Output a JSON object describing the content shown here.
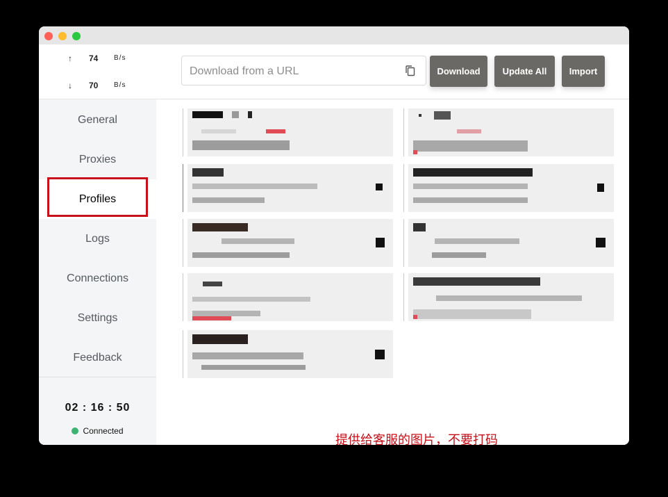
{
  "traffic": {
    "up": {
      "arrow": "↑",
      "value": "74",
      "unit": "B/s"
    },
    "down": {
      "arrow": "↓",
      "value": "70",
      "unit": "B/s"
    }
  },
  "nav": {
    "items": [
      {
        "label": "General"
      },
      {
        "label": "Proxies"
      },
      {
        "label": "Profiles"
      },
      {
        "label": "Logs"
      },
      {
        "label": "Connections"
      },
      {
        "label": "Settings"
      },
      {
        "label": "Feedback"
      }
    ],
    "active": "Profiles"
  },
  "footer": {
    "clock": "02 : 16 : 50",
    "status": "Connected"
  },
  "toolbar": {
    "url_placeholder": "Download from a URL",
    "download_label": "Download",
    "update_all_label": "Update All",
    "import_label": "Import"
  },
  "annotation": "提供给客服的图片，不要打码",
  "colors": {
    "active_highlight": "#c8101a",
    "button_bg": "#6b6966",
    "connected_dot": "#3cb371"
  }
}
